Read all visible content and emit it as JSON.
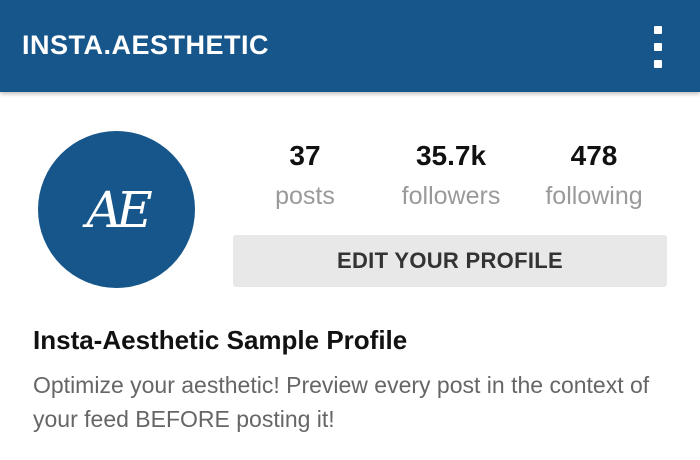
{
  "appbar": {
    "title": "INSTA.AESTHETIC",
    "menu_icon": "more-vertical-icon"
  },
  "avatar": {
    "monogram": "AE"
  },
  "stats": [
    {
      "value": "37",
      "label": "posts"
    },
    {
      "value": "35.7k",
      "label": "followers"
    },
    {
      "value": "478",
      "label": "following"
    }
  ],
  "edit_button": {
    "label": "EDIT YOUR PROFILE"
  },
  "profile": {
    "name": "Insta-Aesthetic Sample Profile",
    "bio": "Optimize your aesthetic! Preview every post in the context of your feed BEFORE posting it!"
  },
  "colors": {
    "primary": "#16568a",
    "button_bg": "#e8e8e8",
    "muted_text": "#9a9a9a"
  }
}
